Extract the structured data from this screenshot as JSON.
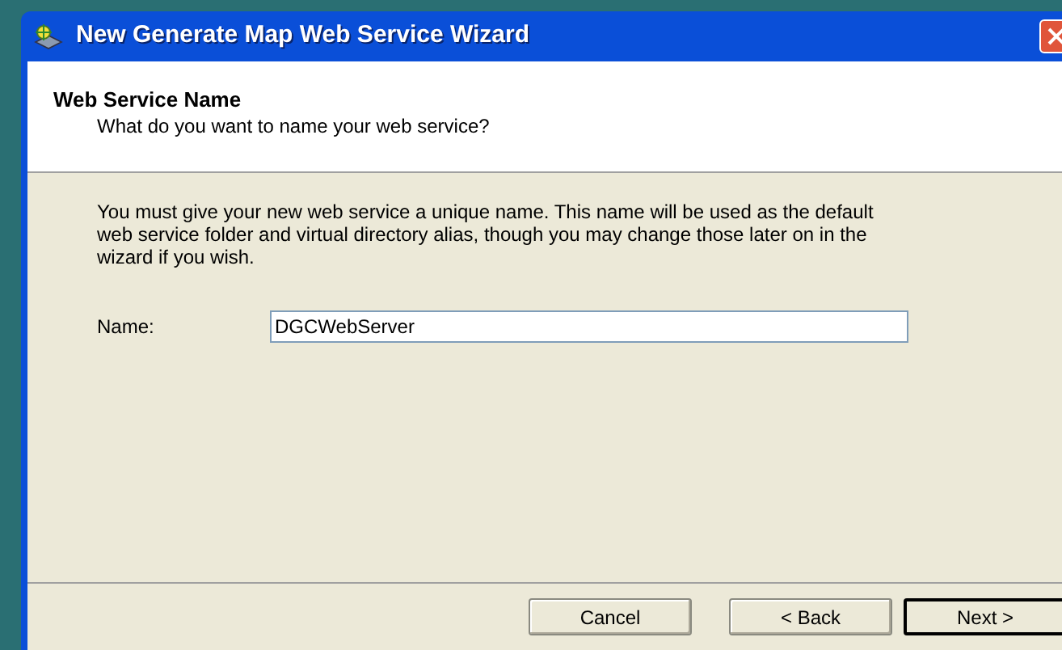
{
  "window": {
    "title": "New Generate Map Web Service Wizard"
  },
  "header": {
    "title": "Web Service Name",
    "subtitle": "What do you want to name your web service?"
  },
  "body": {
    "description": "You must give your new web service a unique name. This name will be used as the default web service folder and virtual directory alias, though you may change those later on in the wizard if you wish.",
    "name_field": {
      "label": "Name:",
      "value": "DGCWebServer"
    }
  },
  "buttons": [
    {
      "label": "Cancel",
      "default": false
    },
    {
      "label": "< Back",
      "default": false
    },
    {
      "label": "Next >",
      "default": true
    }
  ]
}
